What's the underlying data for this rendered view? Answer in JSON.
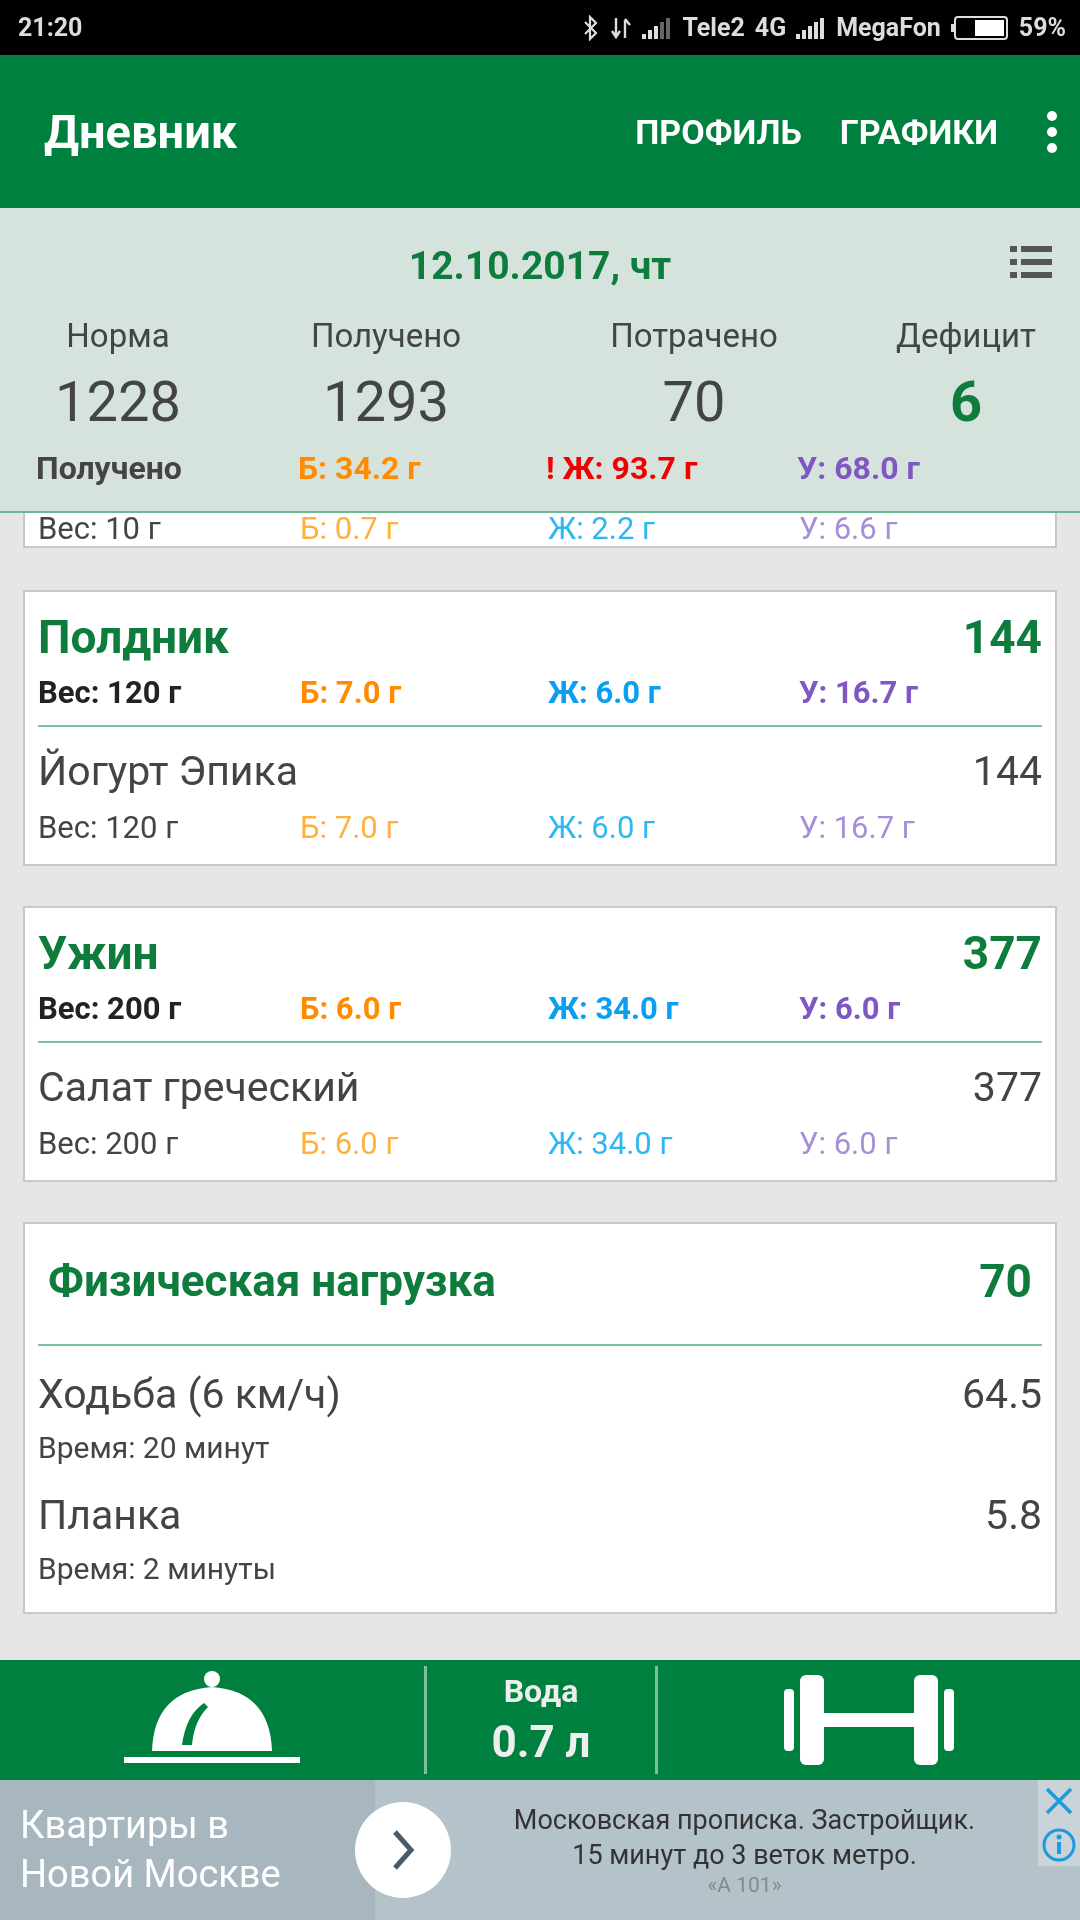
{
  "status_bar": {
    "time": "21:20",
    "carrier_1": "Tele2",
    "network": "4G",
    "carrier_2": "MegaFon",
    "battery": "59%"
  },
  "app_bar": {
    "title": "Дневник",
    "actions": [
      "ПРОФИЛЬ",
      "ГРАФИКИ"
    ]
  },
  "summary": {
    "date": "12.10.2017, чт",
    "stats": [
      {
        "label": "Норма",
        "value": "1228",
        "emphasized": false
      },
      {
        "label": "Получено",
        "value": "1293",
        "emphasized": false
      },
      {
        "label": "Потрачено",
        "value": "70",
        "emphasized": false
      },
      {
        "label": "Дефицит",
        "value": "6",
        "emphasized": true
      }
    ],
    "macros_label": "Получено",
    "macros": [
      {
        "kind": "protein",
        "text": "Б: 34.2 г",
        "warning": false
      },
      {
        "kind": "fat",
        "text": "! Ж: 93.7 г",
        "warning": true
      },
      {
        "kind": "carb",
        "text": "У: 68.0 г",
        "warning": false
      }
    ]
  },
  "hidden_row": {
    "weight": "Вес: 10 г",
    "macros": [
      {
        "kind": "protein",
        "text": "Б: 0.7 г"
      },
      {
        "kind": "fat",
        "text": "Ж: 2.2 г"
      },
      {
        "kind": "carb",
        "text": "У: 6.6 г"
      }
    ]
  },
  "meals": [
    {
      "name": "Полдник",
      "kcal": "144",
      "weight": "Вес: 120 г",
      "macros": [
        {
          "kind": "protein",
          "text": "Б: 7.0 г"
        },
        {
          "kind": "fat",
          "text": "Ж: 6.0 г"
        },
        {
          "kind": "carb",
          "text": "У: 16.7 г"
        }
      ],
      "items": [
        {
          "name": "Йогурт Эпика",
          "kcal": "144",
          "weight": "Вес: 120 г",
          "macros": [
            {
              "kind": "protein",
              "text": "Б: 7.0 г"
            },
            {
              "kind": "fat",
              "text": "Ж: 6.0 г"
            },
            {
              "kind": "carb",
              "text": "У: 16.7 г"
            }
          ]
        }
      ]
    },
    {
      "name": "Ужин",
      "kcal": "377",
      "weight": "Вес: 200 г",
      "macros": [
        {
          "kind": "protein",
          "text": "Б: 6.0 г"
        },
        {
          "kind": "fat",
          "text": "Ж: 34.0 г"
        },
        {
          "kind": "carb",
          "text": "У: 6.0 г"
        }
      ],
      "items": [
        {
          "name": "Салат греческий",
          "kcal": "377",
          "weight": "Вес: 200 г",
          "macros": [
            {
              "kind": "protein",
              "text": "Б: 6.0 г"
            },
            {
              "kind": "fat",
              "text": "Ж: 34.0 г"
            },
            {
              "kind": "carb",
              "text": "У: 6.0 г"
            }
          ]
        }
      ]
    }
  ],
  "activity": {
    "title": "Физическая нагрузка",
    "kcal": "70",
    "items": [
      {
        "name": "Ходьба (6 км/ч)",
        "kcal": "64.5",
        "time": "Время: 20 минут"
      },
      {
        "name": "Планка",
        "kcal": "5.8",
        "time": "Время: 2 минуты"
      }
    ]
  },
  "bottom_nav": {
    "water_label": "Вода",
    "water_value": "0.7 л"
  },
  "ad": {
    "headline": "Квартиры в\nНовой Москве",
    "text": "Московская прописка. Застройщик.\n15 минут до 3 веток метро.",
    "advertiser": "«А 101»"
  }
}
